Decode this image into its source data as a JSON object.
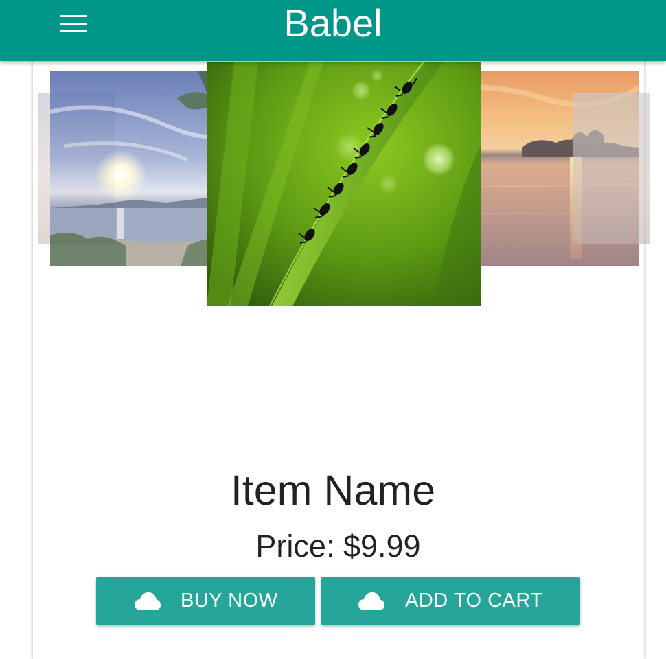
{
  "app": {
    "title": "Babel",
    "brand_color": "#009688",
    "menu_icon": "hamburger-menu-icon"
  },
  "carousel": {
    "items": [
      {
        "name": "far-left",
        "desc": ""
      },
      {
        "name": "beach-sunset",
        "desc": ""
      },
      {
        "name": "ants-on-grass",
        "desc": ""
      },
      {
        "name": "lake-sunset",
        "desc": ""
      },
      {
        "name": "far-right",
        "desc": ""
      }
    ],
    "active_index": 2
  },
  "product": {
    "name": "Item Name",
    "price_label": "Price: $9.99"
  },
  "actions": {
    "buy": {
      "label": "BUY NOW",
      "icon": "cloud-icon"
    },
    "cart": {
      "label": "ADD TO CART",
      "icon": "cloud-icon"
    },
    "button_color": "#26a69a"
  }
}
